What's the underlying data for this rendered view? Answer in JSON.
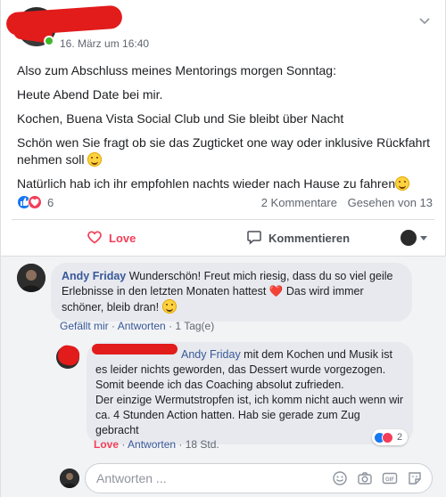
{
  "post": {
    "time": "16. März um 16:40",
    "lines": [
      "Also zum Abschluss meines Mentorings morgen Sonntag:",
      "Heute Abend Date bei mir.",
      "Kochen, Buena Vista Social Club und Sie bleibt über Nacht",
      "Schön wen Sie fragt ob sie das Zugticket one way oder inklusive Rückfahrt nehmen soll",
      "Natürlich hab ich ihr empfohlen nachts wieder nach Hause zu fahren"
    ],
    "reaction_count": "6",
    "comments_count": "2 Kommentare",
    "seen_by": "Gesehen von 13"
  },
  "actions": {
    "love_label": "Love",
    "comment_label": "Kommentieren"
  },
  "comment1": {
    "author": "Andy Friday",
    "text_a": " Wunderschön! Freut mich riesig, dass du so viel geile Erlebnisse in den letzten Monaten hattest ",
    "text_b": " Das wird immer schöner, bleib dran! ",
    "heart": "❤️",
    "like": "Gefällt mir",
    "reply": "Antworten",
    "time": "1 Tag(e)"
  },
  "comment2": {
    "mention": "Andy Friday",
    "text": " mit dem Kochen und Musik ist es leider nichts geworden, das Dessert wurde vorgezogen. Somit beende ich das Coaching absolut zufrieden.",
    "text2": "Der einzige Wermutstropfen ist, ich komm nicht auch wenn wir ca. 4 Stunden Action hatten. Hab sie gerade zum Zug gebracht",
    "love": "Love",
    "reply": "Antworten",
    "time": "18 Std.",
    "reaction_count": "2"
  },
  "reply_box": {
    "placeholder": "Antworten ..."
  },
  "colors": {
    "link": "#385898",
    "love": "#f33e58",
    "like": "#1877f2",
    "redaction": "#e21b1b"
  }
}
